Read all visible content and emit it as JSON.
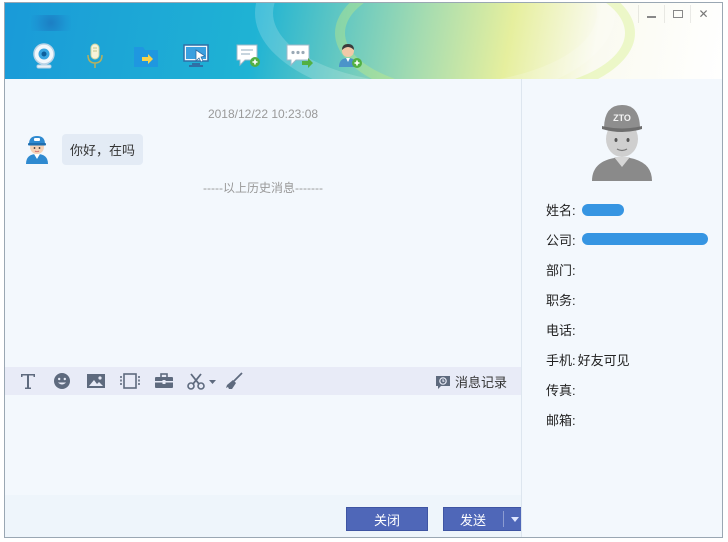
{
  "window": {
    "title": "",
    "controls": [
      "minimize",
      "maximize",
      "close"
    ]
  },
  "toolbar": {
    "items": [
      {
        "name": "video-call-icon"
      },
      {
        "name": "voice-call-icon"
      },
      {
        "name": "send-file-icon"
      },
      {
        "name": "remote-desktop-icon"
      },
      {
        "name": "create-discussion-icon"
      },
      {
        "name": "send-sms-icon"
      },
      {
        "name": "add-contact-icon"
      }
    ]
  },
  "chat": {
    "timestamp": "2018/12/22 10:23:08",
    "message": "你好，在吗",
    "history_divider": "-----以上历史消息-------"
  },
  "input_toolbar": {
    "history_label": "消息记录"
  },
  "buttons": {
    "close": "关闭",
    "send": "发送"
  },
  "profile": {
    "fields": [
      {
        "label": "姓名:",
        "value": ""
      },
      {
        "label": "公司:",
        "value": ""
      },
      {
        "label": "部门:",
        "value": ""
      },
      {
        "label": "职务:",
        "value": ""
      },
      {
        "label": "电话:",
        "value": ""
      },
      {
        "label": "手机:",
        "value": "好友可见"
      },
      {
        "label": "传真:",
        "value": ""
      },
      {
        "label": "邮箱:",
        "value": ""
      }
    ]
  },
  "colors": {
    "accent": "#4f67b8",
    "redaction": "#2b8fe0"
  }
}
